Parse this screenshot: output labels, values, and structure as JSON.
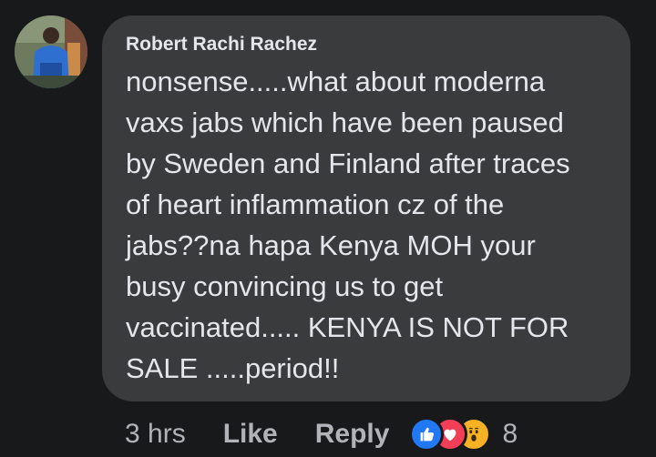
{
  "comment": {
    "author": "Robert Rachi Rachez",
    "text": "nonsense.....what about moderna\nvaxs jabs which have been paused\nby Sweden and Finland after traces\nof heart inflammation cz of the\njabs??na hapa Kenya MOH your\nbusy convincing us to get\nvaccinated..... KENYA IS NOT FOR\nSALE .....period!!"
  },
  "meta": {
    "time": "3 hrs",
    "like_label": "Like",
    "reply_label": "Reply",
    "reaction_count": "8",
    "reactions": [
      "like-icon",
      "love-icon",
      "wow-icon"
    ]
  },
  "colors": {
    "background": "#18191a",
    "bubble": "#3a3b3c",
    "text": "#e4e6eb",
    "secondary_text": "#b0b3b8",
    "like_blue": "#2078f4",
    "love_red": "#f33e58",
    "wow_yellow": "#f7b125"
  }
}
